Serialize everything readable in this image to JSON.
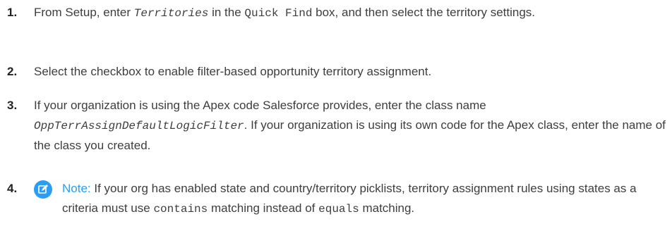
{
  "steps": [
    {
      "number": "1.",
      "p1": "From Setup, enter ",
      "code1": "Territories",
      "p2": " in the ",
      "code2": "Quick Find",
      "p3": " box, and then select the territory settings."
    },
    {
      "number": "2.",
      "text": "Select the checkbox to enable filter-based opportunity territory assignment."
    },
    {
      "number": "3.",
      "p1": "If your organization is using the Apex code Salesforce provides, enter the class name ",
      "code1": "OppTerrAssignDefaultLogicFilter",
      "p2": ". If your organization is using its own code for the Apex class, enter the name of the class you created."
    },
    {
      "number": "4.",
      "note_label": "Note:",
      "p1": " If your org has enabled state and country/territory picklists, territory assignment rules using states as a criteria must use ",
      "code1": "contains",
      "p2": " matching instead of ",
      "code2": "equals",
      "p3": " matching."
    }
  ],
  "icons": {
    "note": "note-edit-icon"
  },
  "colors": {
    "text": "#3e3e3c",
    "accent": "#2a9df4"
  }
}
